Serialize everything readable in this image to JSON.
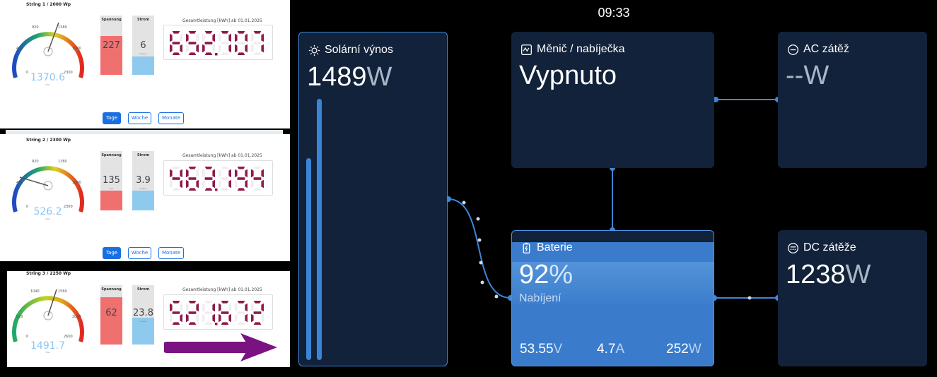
{
  "strings": [
    {
      "title": "String 1 / 2000 Wp",
      "gauge": {
        "value": "1370.6",
        "unit": "Watt",
        "ticks": [
          "920",
          "1380",
          "460",
          "1840",
          "0",
          "2300"
        ],
        "fraction": 0.6
      },
      "voltage": {
        "label": "Spannung",
        "value": "227",
        "unit": "Volt",
        "fill": 0.52
      },
      "current": {
        "label": "Strom",
        "value": "6",
        "unit": "Ampere",
        "fill": 0.33
      },
      "total_label": "Gesamtleistung [kWh] ab 01.01.2025",
      "total": "652.707"
    },
    {
      "title": "String 2 / 2300 Wp",
      "gauge": {
        "value": "526.2",
        "unit": "Watt",
        "ticks": [
          "920",
          "1380",
          "460",
          "1840",
          "0",
          "2300"
        ],
        "fraction": 0.23
      },
      "voltage": {
        "label": "Spannung",
        "value": "135",
        "unit": "Volt",
        "fill": 0.32
      },
      "current": {
        "label": "Strom",
        "value": "3.9",
        "unit": "Ampere",
        "fill": 0.32
      },
      "total_label": "Gesamtleistung [kWh] ab 01.01.2025",
      "total": "463.194"
    },
    {
      "title": "String 3 / 2250 Wp",
      "gauge": {
        "value": "1491.7",
        "unit": "Watt",
        "ticks": [
          "1040",
          "1560",
          "520",
          "2080",
          "0",
          "2600"
        ],
        "fraction": 0.57
      },
      "voltage": {
        "label": "Spannung",
        "value": "62",
        "unit": "Volt",
        "fill": 0.7
      },
      "current": {
        "label": "Strom",
        "value": "23.8",
        "unit": "Ampere",
        "fill": 0.45
      },
      "total_label": "Gesamtleistung [kWh] ab 01.01.2025",
      "total": "521.672"
    }
  ],
  "period_buttons": [
    "Tage",
    "Woche",
    "Monate"
  ],
  "dashboard": {
    "clock": "09:33",
    "solar": {
      "title": "Solární výnos",
      "value": "1489",
      "unit": "W",
      "icon": "sun-icon"
    },
    "inverter": {
      "title": "Měnič / nabíječka",
      "state": "Vypnuto",
      "icon": "inverter-icon"
    },
    "ac_load": {
      "title": "AC zátěž",
      "value": "--",
      "unit": "W",
      "icon": "ac-icon"
    },
    "battery": {
      "title": "Baterie",
      "soc": "92",
      "soc_unit": "%",
      "state": "Nabíjení",
      "voltage": "53.55",
      "voltage_unit": "V",
      "current": "4.7",
      "current_unit": "A",
      "power": "252",
      "power_unit": "W",
      "soc_fraction": 0.92,
      "icon": "battery-icon"
    },
    "dc_load": {
      "title": "DC zátěže",
      "value": "1238",
      "unit": "W",
      "icon": "dc-icon"
    }
  },
  "colors": {
    "tile_bg": "#12223a",
    "accent_blue": "#3b84d6",
    "battery_blue": "#3a7ccb",
    "voltage_bar": "#f07070",
    "current_bar": "#8ec9ee",
    "digit_color": "#8e1a4a",
    "arrow_purple": "#7a1381",
    "button_blue": "#1a6fe0"
  }
}
